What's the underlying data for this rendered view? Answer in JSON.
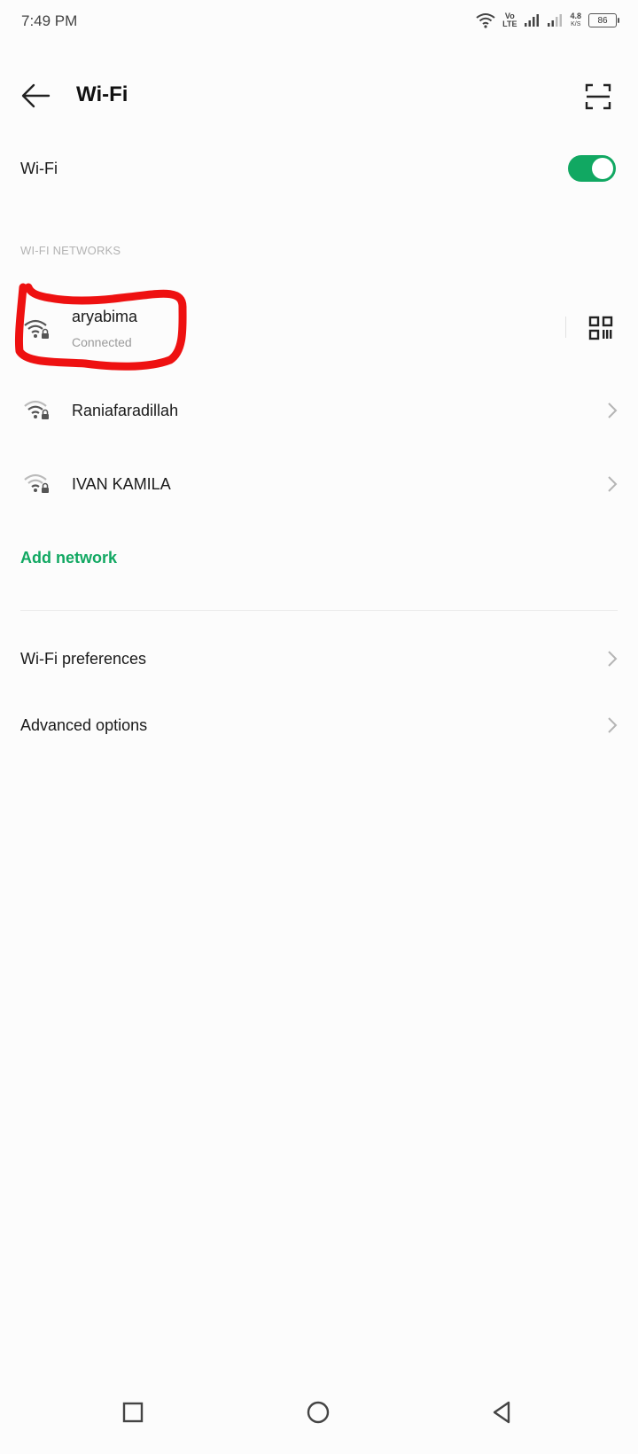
{
  "status_bar": {
    "time": "7:49 PM",
    "volte_top": "Vo",
    "volte_bottom": "LTE",
    "speed_value": "4.8",
    "speed_unit": "K/S",
    "battery": "86"
  },
  "header": {
    "title": "Wi-Fi",
    "back_icon": "back-arrow-icon",
    "scan_icon": "scan-frame-icon"
  },
  "wifi_toggle": {
    "label": "Wi-Fi",
    "enabled": true,
    "accent": "#11a862"
  },
  "networks_section": {
    "header": "WI-FI NETWORKS",
    "items": [
      {
        "name": "aryabima",
        "status": "Connected",
        "icon": "wifi-lock-icon",
        "action_icon": "qr-code-icon"
      },
      {
        "name": "Raniafaradillah",
        "icon": "wifi-lock-icon",
        "action_icon": "chevron-right-icon"
      },
      {
        "name": "IVAN KAMILA",
        "icon": "wifi-lock-icon",
        "action_icon": "chevron-right-icon"
      }
    ],
    "add_network": "Add network"
  },
  "preferences": {
    "items": [
      {
        "label": "Wi-Fi preferences",
        "icon": "chevron-right-icon"
      },
      {
        "label": "Advanced options",
        "icon": "chevron-right-icon"
      }
    ]
  },
  "annotation": {
    "color": "#ee1111"
  },
  "nav_bar": {
    "recents_icon": "square-icon",
    "home_icon": "circle-icon",
    "back_icon": "triangle-back-icon"
  }
}
